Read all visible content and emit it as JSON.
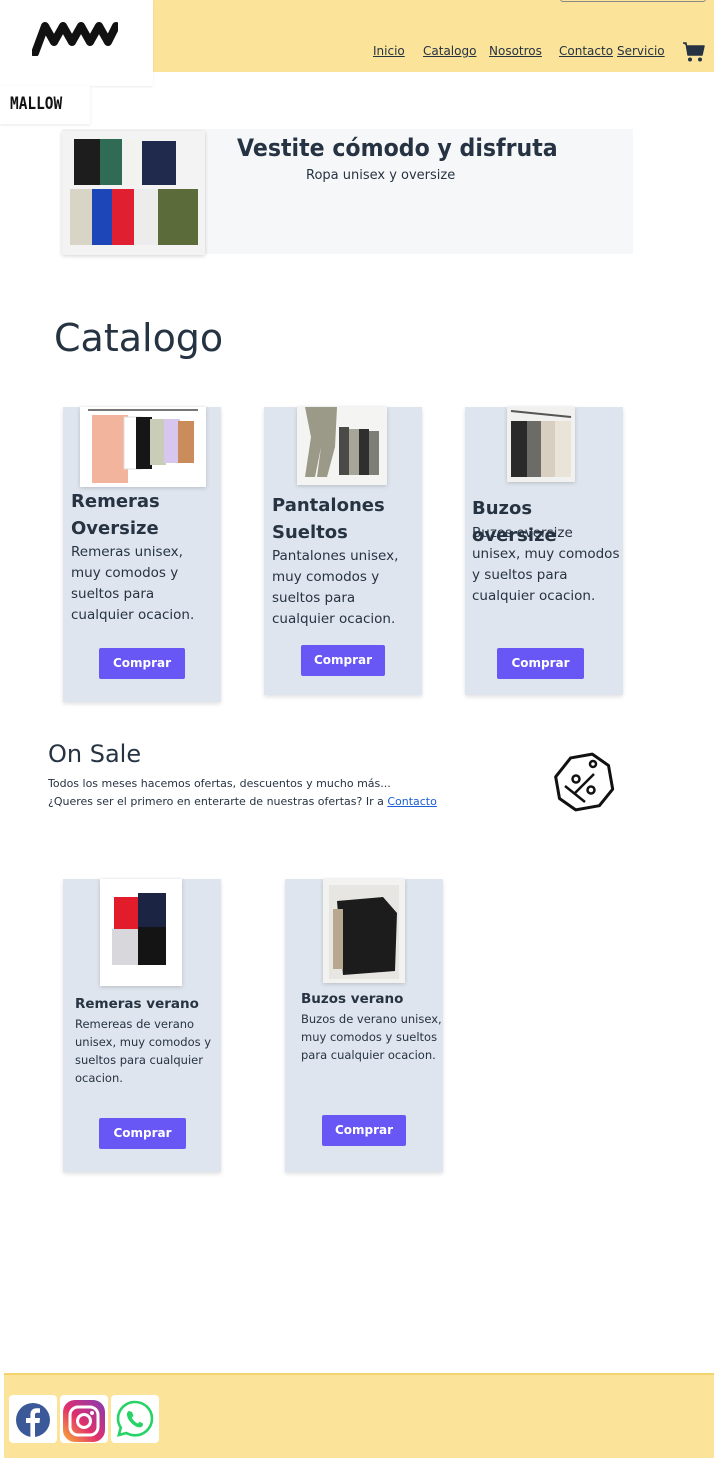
{
  "brand": {
    "logo_icon": "mw-logo-icon",
    "name": "MALLOW"
  },
  "nav": {
    "items": [
      {
        "label": "Inicio"
      },
      {
        "label": "Catalogo"
      },
      {
        "label": "Nosotros"
      },
      {
        "label": "Contacto"
      },
      {
        "label": "Servicio"
      }
    ],
    "cart_icon": "cart-icon"
  },
  "hero": {
    "title": "Vestite cómodo y disfruta",
    "subtitle": "Ropa unisex y oversize"
  },
  "catalog": {
    "title": "Catalogo",
    "products": [
      {
        "title": "Remeras Oversize",
        "description": "Remeras unisex, muy comodos y sueltos para cualquier ocacion.",
        "button": "Comprar"
      },
      {
        "title": "Pantalones Sueltos",
        "description": "Pantalones unisex, muy comodos y sueltos para cualquier ocacion.",
        "button": "Comprar"
      },
      {
        "title": "Buzos oversize",
        "description": "Buzos oversize unisex, muy comodos y sueltos para cualquier ocacion.",
        "button": "Comprar"
      }
    ]
  },
  "sale": {
    "title": "On Sale",
    "line1": "Todos los meses hacemos ofertas, descuentos y mucho más...",
    "line2": "¿Queres ser el primero en enterarte de nuestras ofertas? Ir a",
    "link": "Contacto",
    "icon": "discount-tag-icon",
    "products": [
      {
        "title": "Remeras verano",
        "description": "Remereas de verano unisex, muy comodos y sueltos para cualquier ocacion.",
        "button": "Comprar"
      },
      {
        "title": "Buzos verano",
        "description": "Buzos de verano unisex, muy comodos y sueltos para cualquier ocacion.",
        "button": "Comprar"
      }
    ]
  },
  "footer": {
    "social": [
      {
        "icon": "facebook-icon"
      },
      {
        "icon": "instagram-icon"
      },
      {
        "icon": "whatsapp-icon"
      }
    ]
  },
  "colors": {
    "header_bg": "#fbe39a",
    "button": "#6857f5",
    "card_bg": "#dfe5ee",
    "text": "#263342",
    "link": "#1a5fd6"
  }
}
